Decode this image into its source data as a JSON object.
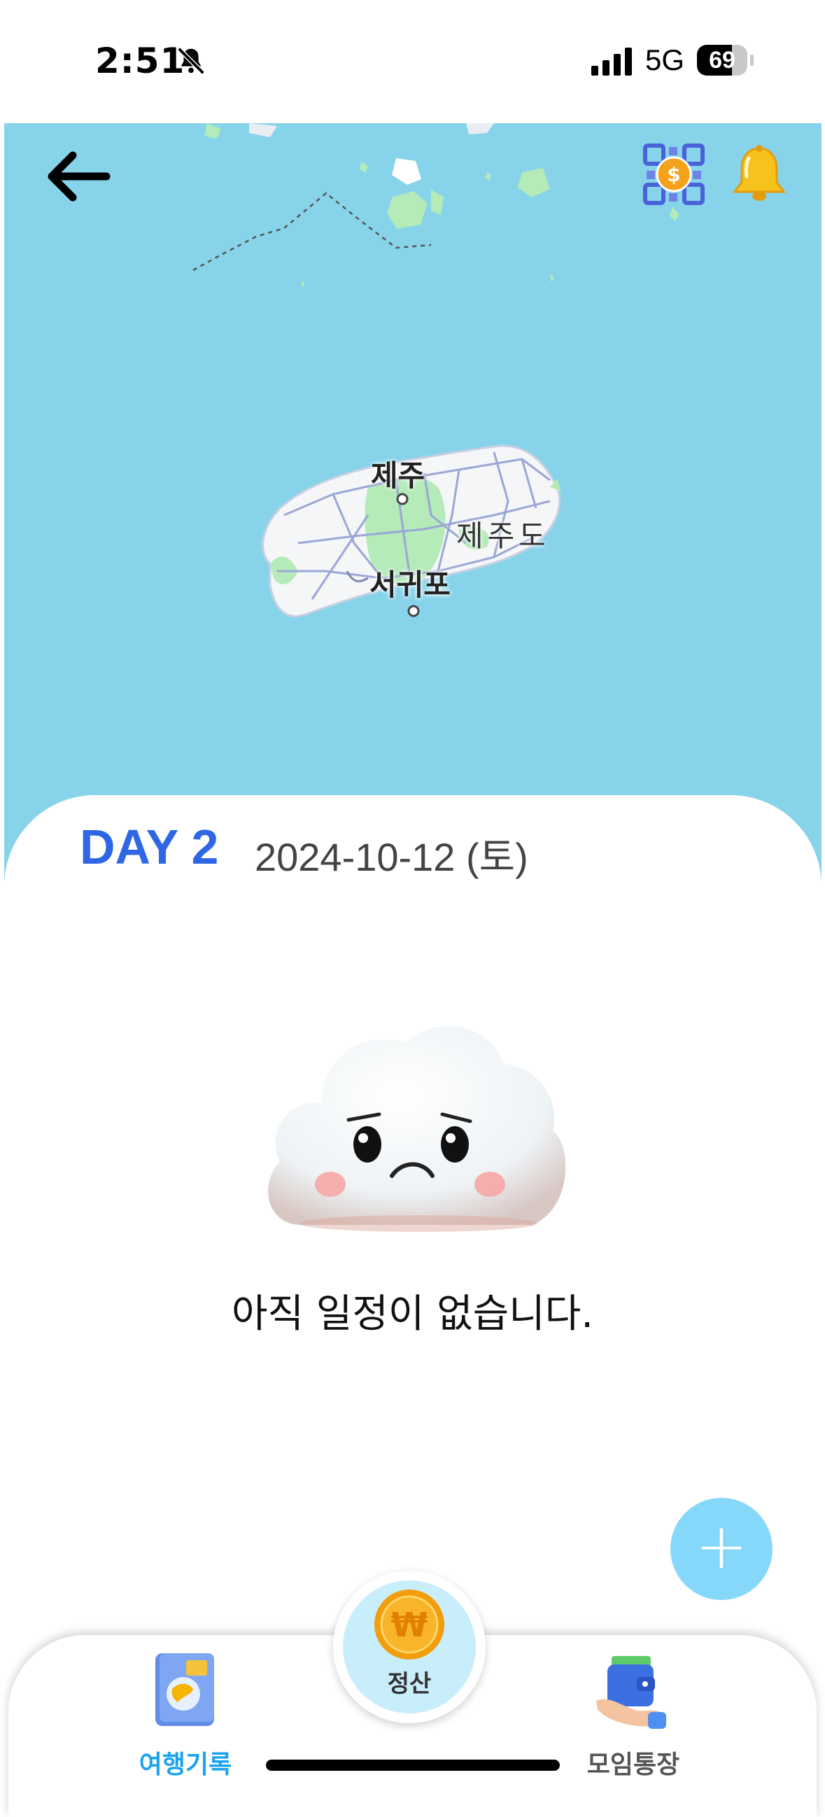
{
  "status_bar": {
    "time": "2:51",
    "network": "5G",
    "battery_percent": "69",
    "battery_level": 0.69,
    "signal_bars": 4
  },
  "map": {
    "labels": {
      "jeju_city": "제주",
      "jeju_island": "제주도",
      "seogwipo": "서귀포"
    },
    "colors": {
      "sea": "#87d4ea",
      "land": "#f4f6f8",
      "park": "#b5eab9"
    }
  },
  "header": {
    "back_icon": "back-arrow-icon",
    "qr_icon": "qr-payment-icon",
    "bell_icon": "bell-icon"
  },
  "schedule": {
    "day": "DAY 2",
    "date": "2024-10-12 (토)",
    "empty_message": "아직 일정이 없습니다."
  },
  "fab": {
    "label": "+"
  },
  "bottom_nav": {
    "left_label": "여행기록",
    "center_label": "정산",
    "right_label": "모임통장",
    "active_color": "#1aa3f0"
  }
}
